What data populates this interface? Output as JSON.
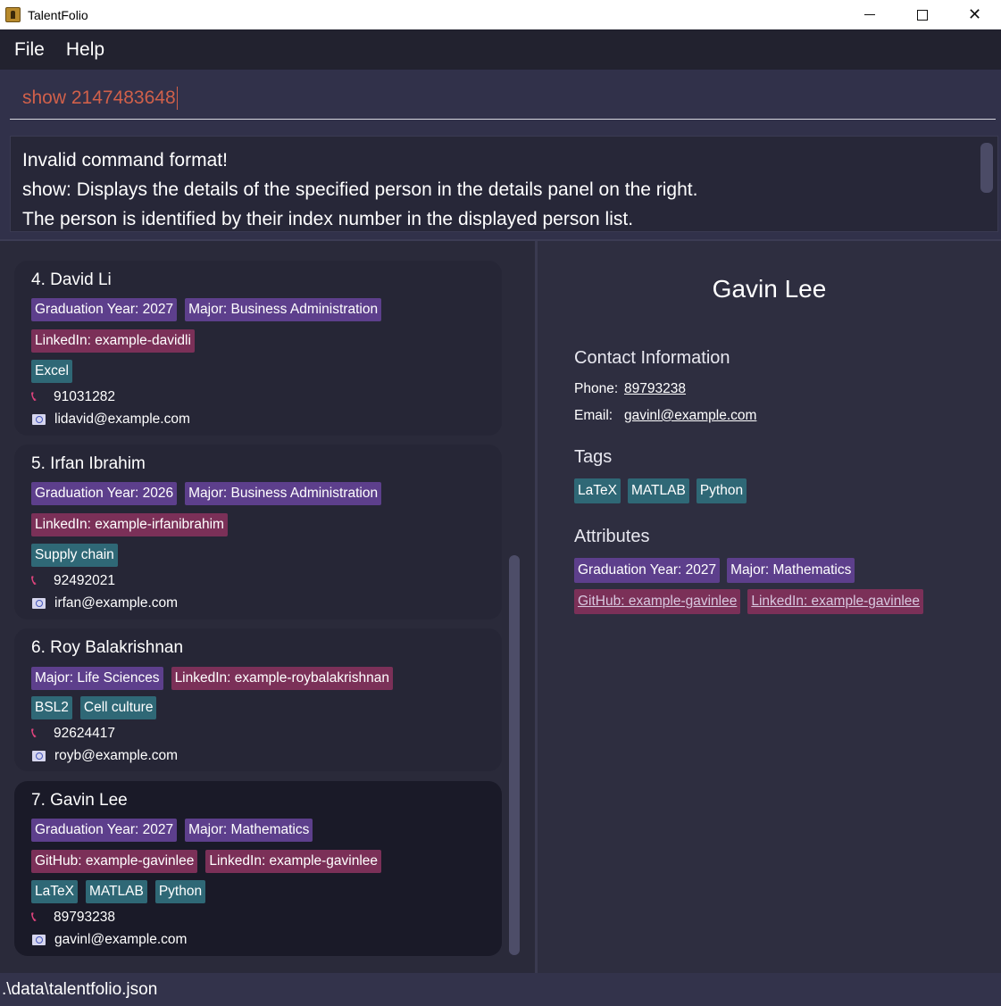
{
  "window": {
    "title": "TalentFolio"
  },
  "menu": {
    "items": [
      "File",
      "Help"
    ]
  },
  "command": {
    "value": "show 2147483648"
  },
  "result": {
    "lines": [
      "Invalid command format!",
      "show: Displays the details of the specified person in the details panel on the right.",
      "The person is identified by their index number in the displayed person list."
    ]
  },
  "persons": [
    {
      "title": "4. David Li",
      "attr_row1": [
        "Graduation Year: 2027",
        "Major: Business Administration"
      ],
      "attr_row2": [
        "LinkedIn: example-davidli"
      ],
      "tags": [
        "Excel"
      ],
      "phone": "91031282",
      "email": "lidavid@example.com"
    },
    {
      "title": "5. Irfan Ibrahim",
      "attr_row1": [
        "Graduation Year: 2026",
        "Major: Business Administration"
      ],
      "attr_row2": [
        "LinkedIn: example-irfanibrahim"
      ],
      "tags": [
        "Supply chain"
      ],
      "phone": "92492021",
      "email": "irfan@example.com"
    },
    {
      "title": "6. Roy Balakrishnan",
      "attr_row1": [
        "Major: Life Sciences",
        "LinkedIn: example-roybalakrishnan"
      ],
      "tags": [
        "BSL2",
        "Cell culture"
      ],
      "phone": "92624417",
      "email": "royb@example.com"
    },
    {
      "title": "7. Gavin Lee",
      "attr_row1": [
        "Graduation Year: 2027",
        "Major: Mathematics"
      ],
      "attr_row2": [
        "GitHub: example-gavinlee",
        "LinkedIn: example-gavinlee"
      ],
      "tags": [
        "LaTeX",
        "MATLAB",
        "Python"
      ],
      "phone": "89793238",
      "email": "gavinl@example.com"
    }
  ],
  "details": {
    "name": "Gavin Lee",
    "contact_heading": "Contact Information",
    "phone_label": "Phone:",
    "phone": "89793238",
    "email_label": "Email:",
    "email": "gavinl@example.com",
    "tags_heading": "Tags",
    "tags": [
      "LaTeX",
      "MATLAB",
      "Python"
    ],
    "attributes_heading": "Attributes",
    "attributes_row1": [
      "Graduation Year: 2027",
      "Major: Mathematics"
    ],
    "attributes_row2": [
      "GitHub: example-gavinlee",
      "LinkedIn: example-gavinlee"
    ]
  },
  "status": {
    "path": ".\\data\\talentfolio.json"
  },
  "colors": {
    "attr_purple": "#5d3f8c",
    "attr_pink": "#7b3058",
    "skill_teal": "#2f6876",
    "phone_icon": "#e2447e",
    "command_text": "#d0604a"
  }
}
